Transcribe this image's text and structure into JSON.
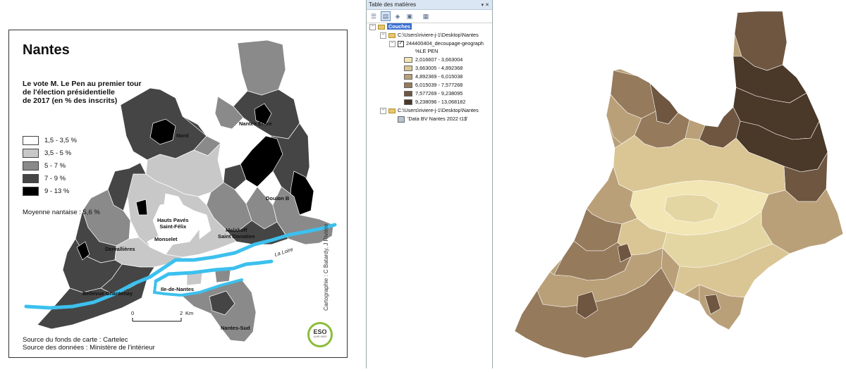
{
  "left_map": {
    "title": "Nantes",
    "subtitle": "Le vote M. Le Pen au premier tour\nde l'élection présidentielle\nde 2017 (en % des inscrits)",
    "legend": [
      {
        "label": "1,5 - 3,5 %",
        "color": "#ffffff"
      },
      {
        "label": "3,5 - 5 %",
        "color": "#c8c8c8"
      },
      {
        "label": "5 - 7 %",
        "color": "#8a8a8a"
      },
      {
        "label": "7 - 9 %",
        "color": "#454545"
      },
      {
        "label": "9 - 13 %",
        "color": "#000000"
      }
    ],
    "mean": "Moyenne nantaise : 5,6 %",
    "districts": [
      {
        "name": "Nord"
      },
      {
        "name": "Nantes Erdre"
      },
      {
        "name": "Doulon B"
      },
      {
        "name": "Hauts Pavés\nSaint-Félix"
      },
      {
        "name": "Malakoff\nSaint Donatien"
      },
      {
        "name": "Dervallières"
      },
      {
        "name": "Monselet"
      },
      {
        "name": "Bellevue Chantenay"
      },
      {
        "name": "Ile-de-Nantes"
      },
      {
        "name": "Nantes-Sud"
      }
    ],
    "river_label": "La Loire",
    "scale": {
      "start": "0",
      "end": "2",
      "unit": "Km"
    },
    "credit": "Cartographie : C Batardy, J Rivière",
    "sources": [
      "Source du fonds de carte : Cartelec",
      "Source des données : Ministère de l'intérieur"
    ],
    "logo": {
      "text": "ESO",
      "sub": "UMR 6590"
    }
  },
  "toc": {
    "title": "Table des matières",
    "window_buttons": "▾ ✕",
    "toolbar_icons": [
      "list-by-drawing-order-icon",
      "list-by-source-icon",
      "list-by-visibility-icon",
      "list-by-selection-icon",
      "options-icon"
    ],
    "root": "Couches",
    "folder1": "C:\\Users\\riviere-j-1\\Desktop\\Nantes",
    "layer1": "244400404_decoupage-geograph",
    "field": "%LE PEN",
    "classes": [
      {
        "label": "2,016607 - 3,663004",
        "color": "#f1e6b4"
      },
      {
        "label": "3,663005 - 4,892368",
        "color": "#d9c694"
      },
      {
        "label": "4,892369 - 6,015038",
        "color": "#b9a079"
      },
      {
        "label": "6,015039 - 7,577268",
        "color": "#957a5c"
      },
      {
        "label": "7,577269 - 9,238095",
        "color": "#6f5640"
      },
      {
        "label": "9,238096 - 13,068182",
        "color": "#4a3828"
      }
    ],
    "folder2": "C:\\Users\\riviere-j-1\\Desktop\\Nantes",
    "table": "'Data BV Nantes 2022 t1$'"
  }
}
